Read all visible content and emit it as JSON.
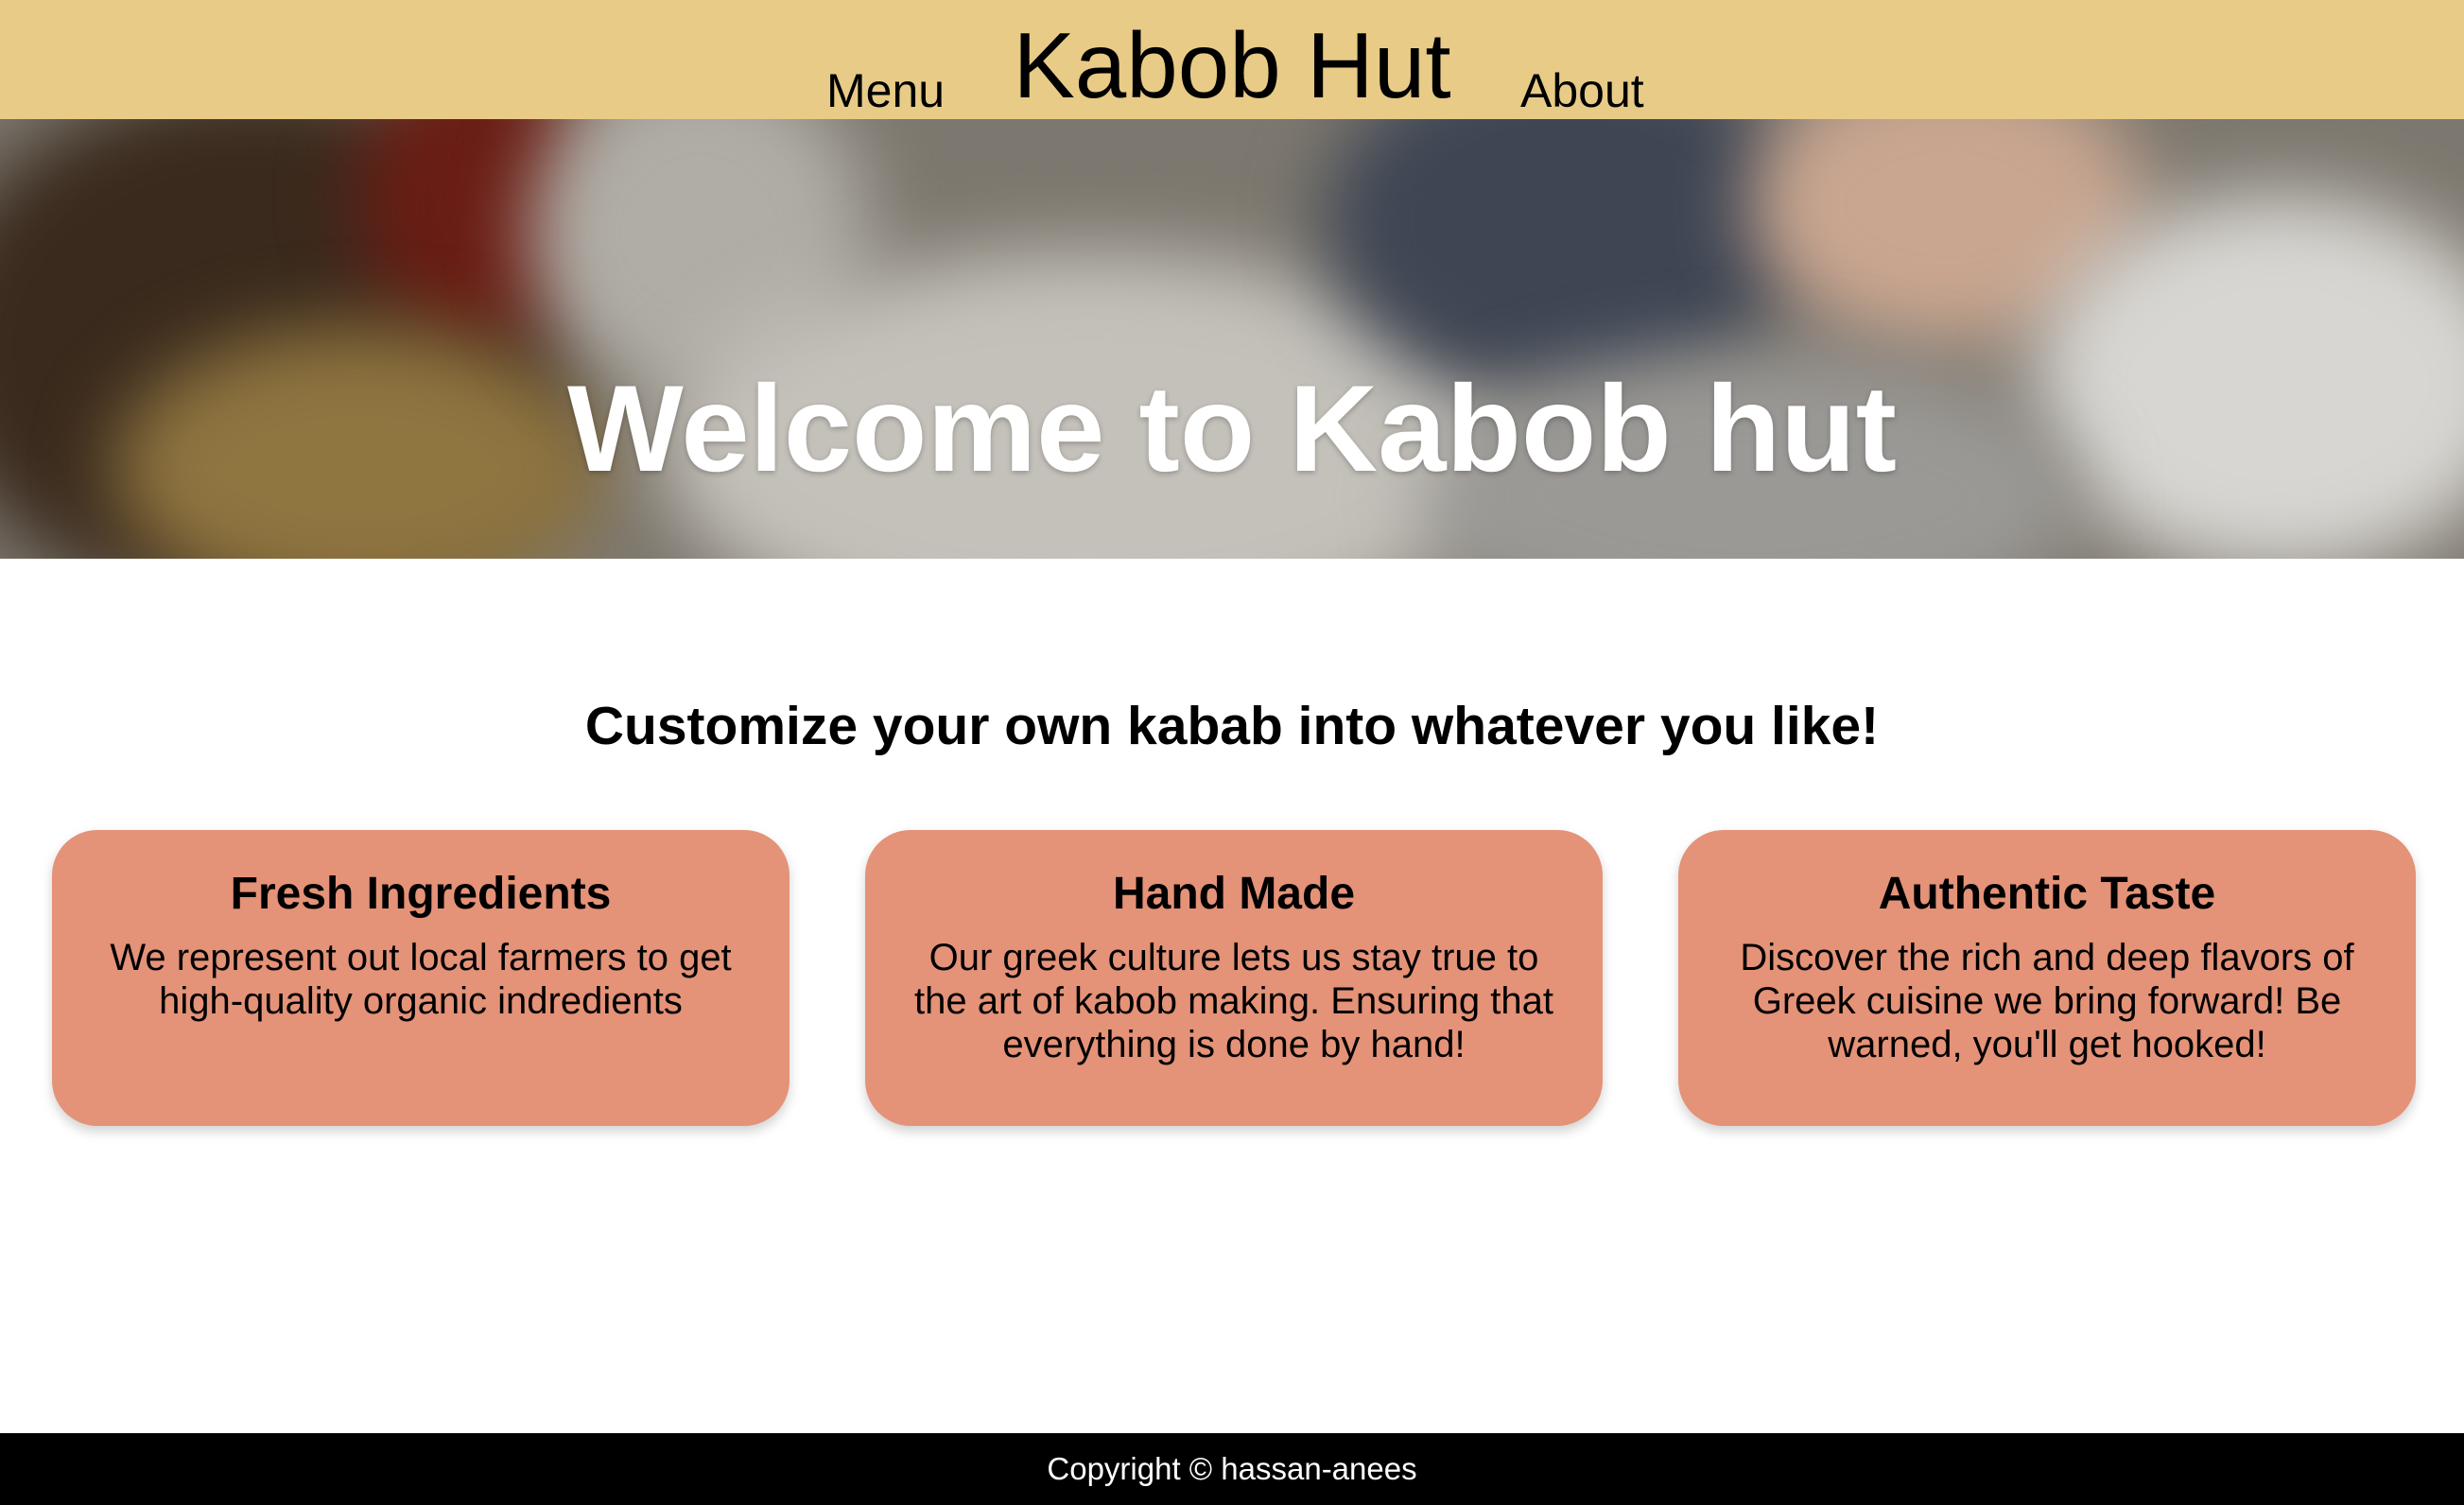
{
  "header": {
    "brand": "Kabob Hut",
    "nav": {
      "menu": "Menu",
      "about": "About"
    },
    "background_color": "#e8cb86"
  },
  "hero": {
    "title": "Welcome to Kabob hut"
  },
  "tagline": "Customize your own kabab into whatever you like!",
  "features": [
    {
      "title": "Fresh Ingredients",
      "text": "We represent out local farmers to get high-quality organic indredients"
    },
    {
      "title": "Hand Made",
      "text": "Our greek culture lets us stay true to the art of kabob making. Ensuring that everything is done by hand!"
    },
    {
      "title": "Authentic Taste",
      "text": "Discover the rich and deep flavors of Greek cuisine we bring forward! Be warned, you'll get hooked!"
    }
  ],
  "card_color": "#e49278",
  "footer": {
    "copyright": "Copyright © hassan-anees"
  }
}
